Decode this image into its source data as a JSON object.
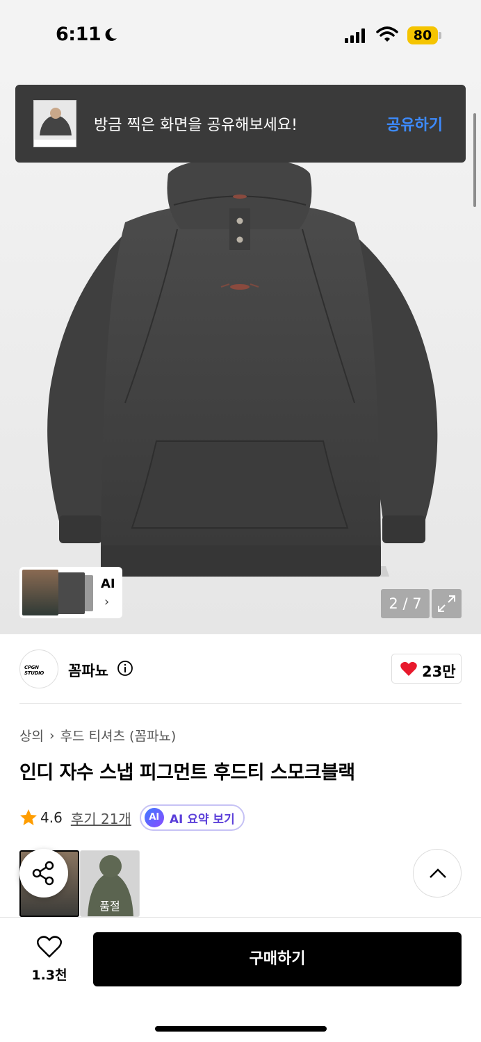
{
  "status_bar": {
    "time": "6:11",
    "battery": "80"
  },
  "toast": {
    "message": "방금 찍은 화면을 공유해보세요!",
    "action": "공유하기"
  },
  "gallery": {
    "ai_label": "AI",
    "counter": "2 / 7"
  },
  "brand": {
    "logo_text": "CPGN STUDIO",
    "name": "꼼파뇨",
    "likes": "23만"
  },
  "breadcrumb": {
    "category": "상의",
    "subcategory": "후드 티셔츠 (꼼파뇨)"
  },
  "product": {
    "title": "인디 자수 스냅 피그먼트 후드티 스모크블랙",
    "rating": "4.6",
    "reviews": "후기 21개",
    "ai_badge": "AI",
    "ai_summary": "AI 요약 보기"
  },
  "options": [
    {
      "sold_out_label": ""
    },
    {
      "sold_out_label": "품절"
    }
  ],
  "bottom_bar": {
    "wish_count": "1.3천",
    "buy_label": "구매하기"
  },
  "colors": {
    "accent_blue": "#3d8bff",
    "heart_red": "#e8192c",
    "star": "#ff9d00",
    "ai_purple": "#5b3fd9"
  }
}
